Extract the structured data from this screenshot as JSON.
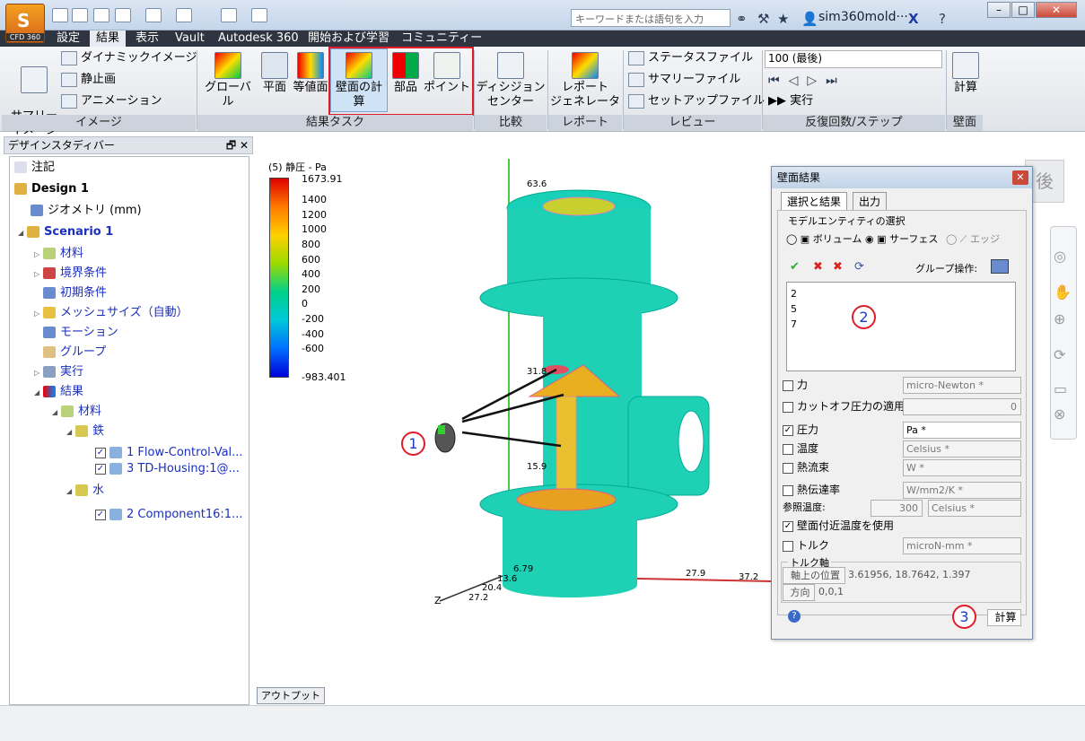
{
  "app": {
    "logo_label": "CFD 360"
  },
  "titlebar": {
    "search_placeholder": "キーワードまたは語句を入力",
    "username": "sim360mold···"
  },
  "menu": [
    "設定",
    "結果",
    "表示",
    "Vault",
    "Autodesk 360",
    "開始および学習",
    "コミュニティー"
  ],
  "ribbon": {
    "image": {
      "summary": "サマリー\nイメージ",
      "dynamic": "ダイナミックイメージ",
      "still": "静止画",
      "animation": "アニメーション",
      "group": "イメージ"
    },
    "tasks": {
      "global": "グローバル",
      "plane": "平面",
      "isosurface": "等値面",
      "wall": "壁面の計算",
      "parts": "部品",
      "point": "ポイント",
      "group": "結果タスク"
    },
    "compare": {
      "decision": "ディシジョン\nセンター",
      "group": "比較"
    },
    "report": {
      "generator": "レポート\nジェネレータ",
      "group": "レポート"
    },
    "review": {
      "status": "ステータスファイル",
      "summary": "サマリーファイル",
      "setup": "セットアップファイル",
      "group": "レビュー"
    },
    "iteration": {
      "select": "100 (最後)",
      "run": "実行",
      "group": "反復回数/ステップ"
    },
    "wall": {
      "calc": "計算",
      "group": "壁面"
    }
  },
  "left_panel": {
    "title": "デザインスタディバー",
    "items": {
      "notes": "注記",
      "design": "Design 1",
      "geometry": "ジオメトリ (mm)",
      "scenario": "Scenario 1",
      "material": "材料",
      "boundary": "境界条件",
      "initial": "初期条件",
      "mesh": "メッシュサイズ（自動）",
      "motion": "モーション",
      "group": "グループ",
      "run": "実行",
      "results": "結果",
      "res_material": "材料",
      "iron": "鉄",
      "part1": "1 Flow-Control-Val...",
      "part3": "3 TD-Housing:1@...",
      "water": "水",
      "part2": "2 Component16:1..."
    }
  },
  "legend": {
    "title": "(5) 静圧 - Pa",
    "ticks": [
      "1673.91",
      "1400",
      "1200",
      "1000",
      "800",
      "600",
      "400",
      "200",
      "0",
      "-200",
      "-400",
      "-600",
      "-983.401"
    ]
  },
  "axes": {
    "y": [
      "63.6",
      "31.8",
      "15.9"
    ],
    "x": [
      "27.9",
      "37.2"
    ],
    "z": [
      "6.79",
      "13.6",
      "20.4",
      "27.2"
    ],
    "zlabel": "Z"
  },
  "viewcube_face": "後",
  "dialog": {
    "title": "壁面結果",
    "tabs": [
      "選択と結果",
      "出力"
    ],
    "section": "モデルエンティティの選択",
    "radios": [
      "ボリューム",
      "サーフェス",
      "エッジ"
    ],
    "group_op": "グループ操作:",
    "selected": [
      "2",
      "5",
      "7"
    ],
    "rows": {
      "force": {
        "label": "力",
        "unit": "micro-Newton *"
      },
      "cutoff": {
        "label": "カットオフ圧力の適用",
        "value": "0"
      },
      "pressure": {
        "label": "圧力",
        "unit": "Pa *"
      },
      "temp": {
        "label": "温度",
        "unit": "Celsius *"
      },
      "heatflux": {
        "label": "熱流束",
        "unit": "W *"
      },
      "htc": {
        "label": "熱伝達率",
        "unit": "W/mm2/K *"
      },
      "reftemp": {
        "label": "参照温度:",
        "value": "300",
        "unit": "Celsius *"
      },
      "nearwall": {
        "label": "壁面付近温度を使用"
      },
      "torque": {
        "label": "トルク",
        "unit": "microN-mm *"
      }
    },
    "torque_axis": {
      "title": "トルク軸",
      "pos_btn": "軸上の位置",
      "pos_val": "3.61956, 18.7642, 1.397",
      "dir_btn": "方向",
      "dir_val": "0,0,1"
    },
    "calc_btn": "計算"
  },
  "callouts": [
    "1",
    "2",
    "3"
  ],
  "output_bar": "アウトプットバー"
}
